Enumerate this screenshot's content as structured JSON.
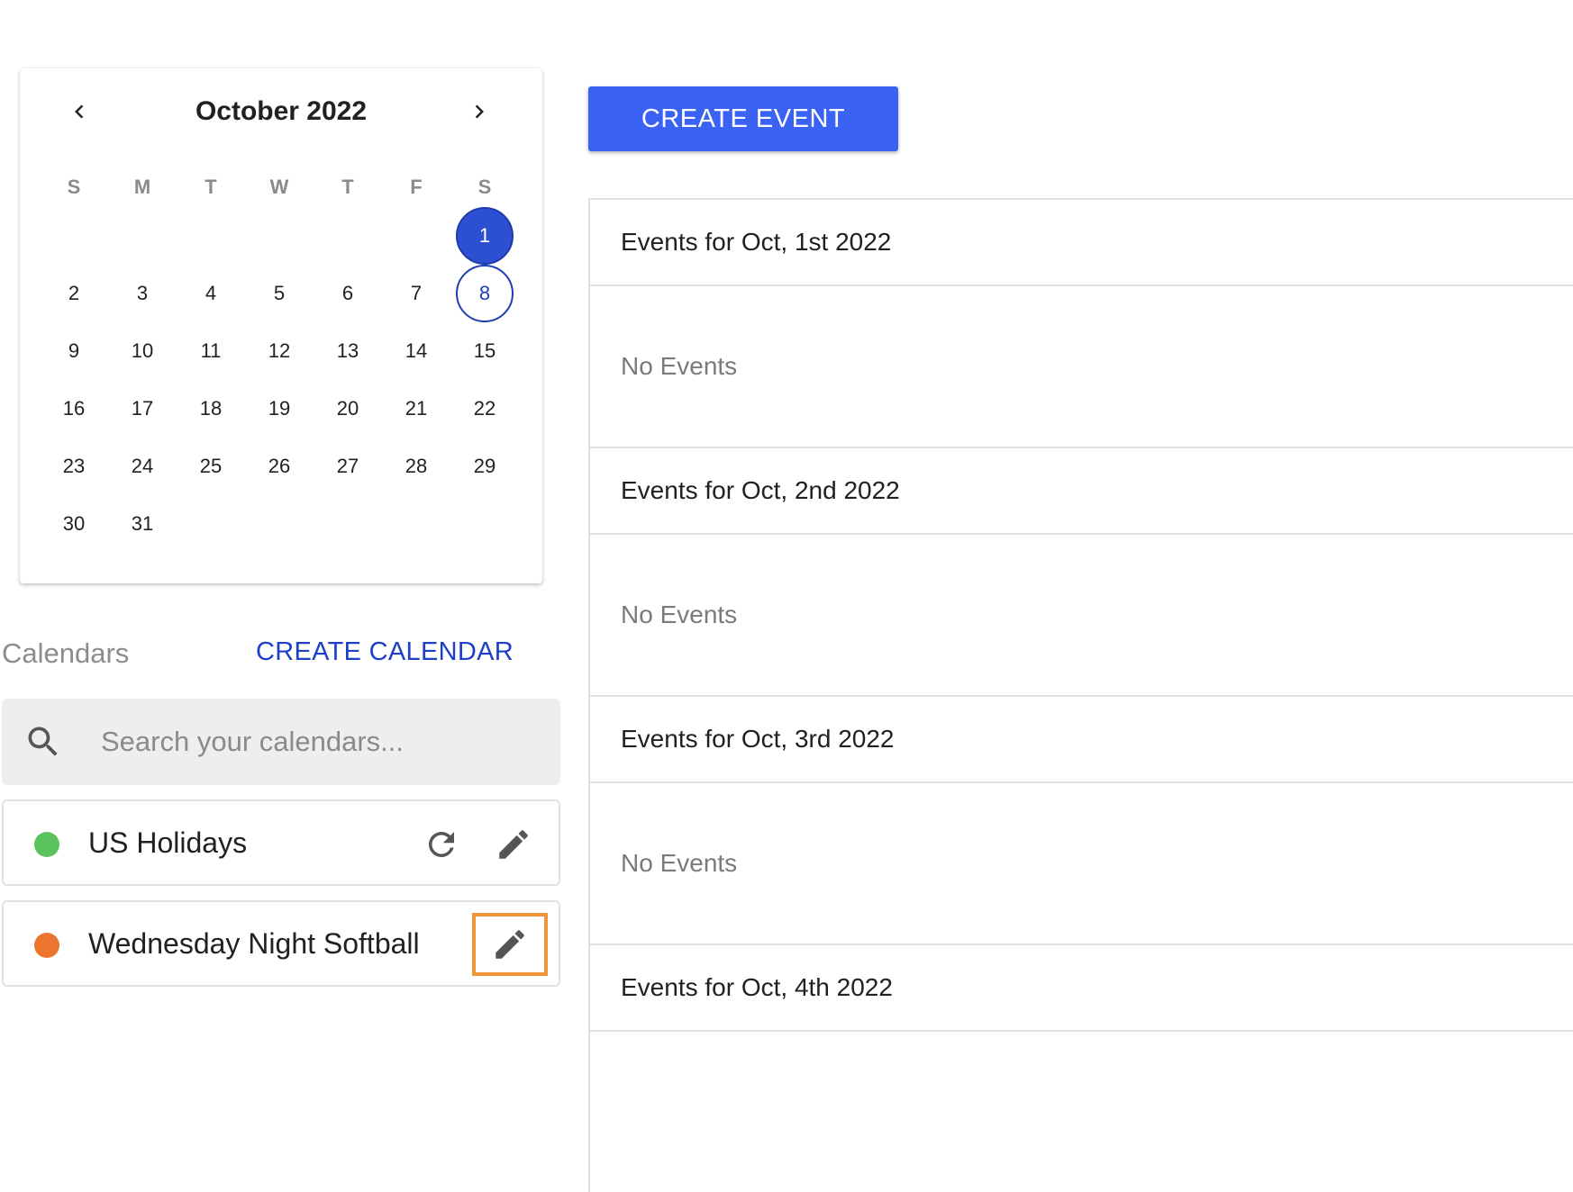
{
  "calendar_widget": {
    "month_label": "October 2022",
    "weekdays": [
      "S",
      "M",
      "T",
      "W",
      "T",
      "F",
      "S"
    ],
    "weeks": [
      [
        "",
        "",
        "",
        "",
        "",
        "",
        "1"
      ],
      [
        "2",
        "3",
        "4",
        "5",
        "6",
        "7",
        "8"
      ],
      [
        "9",
        "10",
        "11",
        "12",
        "13",
        "14",
        "15"
      ],
      [
        "16",
        "17",
        "18",
        "19",
        "20",
        "21",
        "22"
      ],
      [
        "23",
        "24",
        "25",
        "26",
        "27",
        "28",
        "29"
      ],
      [
        "30",
        "31",
        "",
        "",
        "",
        "",
        ""
      ]
    ],
    "selected_day": "1",
    "today_day": "8",
    "icons": {
      "prev": "chevron-left-icon",
      "next": "chevron-right-icon"
    }
  },
  "calendars": {
    "heading": "Calendars",
    "create_label": "CREATE CALENDAR",
    "search_placeholder": "Search your calendars...",
    "items": [
      {
        "name": "US Holidays",
        "color": "#5ac35e",
        "actions": [
          "refresh-icon",
          "edit-icon"
        ]
      },
      {
        "name": "Wednesday Night Softball",
        "color": "#ec7630",
        "actions": [
          "edit-icon"
        ]
      }
    ]
  },
  "events": {
    "create_label": "CREATE EVENT",
    "days": [
      {
        "heading": "Events for Oct, 1st 2022",
        "body": "No Events"
      },
      {
        "heading": "Events for Oct, 2nd 2022",
        "body": "No Events"
      },
      {
        "heading": "Events for Oct, 3rd 2022",
        "body": "No Events"
      },
      {
        "heading": "Events for Oct, 4th 2022",
        "body": ""
      }
    ]
  },
  "colors": {
    "accent": "#3a63f6",
    "link": "#1d3fc9",
    "selected_day": "#2d4fd1",
    "highlight_outline": "#f0963a"
  }
}
